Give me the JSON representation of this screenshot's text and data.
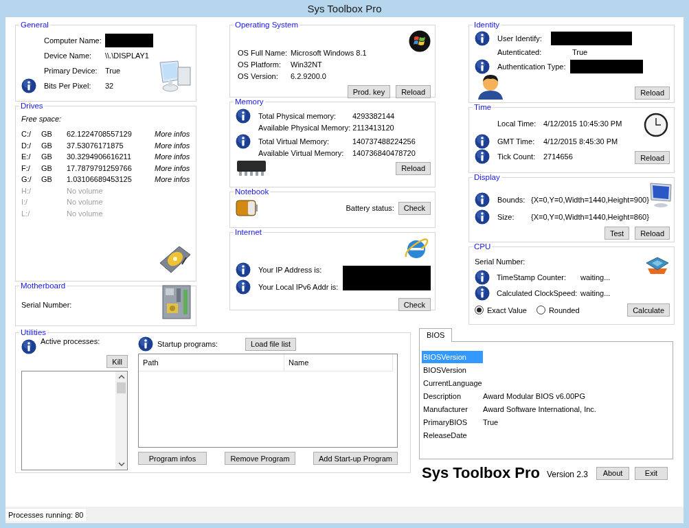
{
  "window": {
    "title": "Sys Toolbox Pro"
  },
  "general": {
    "title": "General",
    "fields": [
      {
        "label": "Computer Name:",
        "redacted": true,
        "info": false
      },
      {
        "label": "Device Name:",
        "value": "\\\\.\\DISPLAY1",
        "info": false
      },
      {
        "label": "Primary Device:",
        "value": "True",
        "info": false
      },
      {
        "label": "Bits Per Pixel:",
        "value": "32",
        "info": true
      }
    ]
  },
  "drives": {
    "title": "Drives",
    "heading": "Free space:",
    "items": [
      {
        "letter": "C:/",
        "unit": "GB",
        "free": "62.1224708557129",
        "link": "More infos",
        "available": true
      },
      {
        "letter": "D:/",
        "unit": "GB",
        "free": "37.53076171875",
        "link": "More infos",
        "available": true
      },
      {
        "letter": "E:/",
        "unit": "GB",
        "free": "30.3294906616211",
        "link": "More infos",
        "available": true
      },
      {
        "letter": "F:/",
        "unit": "GB",
        "free": "17.7879791259766",
        "link": "More infos",
        "available": true
      },
      {
        "letter": "G:/",
        "unit": "GB",
        "free": "1.03106689453125",
        "link": "More infos",
        "available": true
      },
      {
        "letter": "H:/",
        "free": "No volume",
        "available": false
      },
      {
        "letter": "I:/",
        "free": "No volume",
        "available": false
      },
      {
        "letter": "L:/",
        "free": "No volume",
        "available": false
      }
    ]
  },
  "motherboard": {
    "title": "Motherboard",
    "label": "Serial Number:"
  },
  "os": {
    "title": "Operating System",
    "fields": [
      {
        "label": "OS Full Name:",
        "value": "Microsoft Windows 8.1",
        "info": false
      },
      {
        "label": "OS Platform:",
        "value": "Win32NT",
        "info": false
      },
      {
        "label": "OS Version:",
        "value": "6.2.9200.0",
        "info": false
      }
    ],
    "buttons": [
      "Prod. key",
      "Reload"
    ]
  },
  "memory": {
    "title": "Memory",
    "fields": [
      {
        "label": "Total Physical memory:",
        "value": "4293382144",
        "info": true
      },
      {
        "label": "Available Physical Memory:",
        "value": "2113413120",
        "info": false
      },
      {
        "label": "Total Virtual Memory:",
        "value": "140737488224256",
        "info": true
      },
      {
        "label": "Available Virtual Memory:",
        "value": "140736840478720",
        "info": false
      }
    ],
    "buttons": [
      "Reload"
    ]
  },
  "notebook": {
    "title": "Notebook",
    "label": "Battery status:",
    "button": "Check"
  },
  "internet": {
    "title": "Internet",
    "redacted": true,
    "fields": [
      {
        "label": "Your IP Address is:",
        "info": true
      },
      {
        "label": "Your Local IPv6 Addr is:",
        "info": true
      }
    ],
    "button": "Check"
  },
  "identity": {
    "title": "Identity",
    "fields": [
      {
        "label": "User Identify:",
        "redacted": true,
        "info": true
      },
      {
        "label": "Autenticated:",
        "value": "True",
        "info": false
      },
      {
        "label": "Authentication Type:",
        "redacted": true,
        "info": true
      }
    ],
    "button": "Reload"
  },
  "time": {
    "title": "Time",
    "fields": [
      {
        "label": "Local Time:",
        "value": "4/12/2015 10:45:30 PM",
        "info": false
      },
      {
        "label": "GMT Time:",
        "value": "4/12/2015 8:45:30 PM",
        "info": true
      },
      {
        "label": "Tick Count:",
        "value": "2714656",
        "info": true
      }
    ],
    "button": "Reload"
  },
  "display": {
    "title": "Display",
    "fields": [
      {
        "label": "Bounds:",
        "value": "{X=0,Y=0,Width=1440,Height=900}",
        "info": true
      },
      {
        "label": "Size:",
        "value": "{X=0,Y=0,Width=1440,Height=860}",
        "info": true
      }
    ],
    "buttons": [
      "Test",
      "Reload"
    ]
  },
  "cpu": {
    "title": "CPU",
    "serial_label": "Serial Number:",
    "fields": [
      {
        "label": "TimeStamp Counter:",
        "value": "waiting...",
        "info": true
      },
      {
        "label": "Calculated ClockSpeed:",
        "value": "waiting...",
        "info": true
      }
    ],
    "radios": [
      {
        "label": "Exact Value",
        "selected": true
      },
      {
        "label": "Rounded",
        "selected": false
      }
    ],
    "button": "Calculate"
  },
  "utilities": {
    "title": "Utilities",
    "processes_label": "Active processes:",
    "kill_button": "Kill",
    "startup_label": "Startup programs:",
    "load_button": "Load file list",
    "columns": [
      "Path",
      "Name"
    ],
    "buttons": [
      "Program infos",
      "Remove Program",
      "Add Start-up Program"
    ]
  },
  "bios": {
    "tabs": [
      {
        "label": "BIOS",
        "selected": true
      }
    ],
    "rows": [
      {
        "name": "BIOSVersion",
        "selected": true
      },
      {
        "name": "BIOSVersion",
        "selected": false
      },
      {
        "name": "CurrentLanguage",
        "selected": false
      },
      {
        "name": "Description",
        "value": "Award Modular BIOS v6.00PG",
        "selected": false
      },
      {
        "name": "Manufacturer",
        "value": "Award Software International, Inc.",
        "selected": false
      },
      {
        "name": "PrimaryBIOS",
        "value": "True",
        "selected": false
      },
      {
        "name": "ReleaseDate",
        "selected": false
      }
    ]
  },
  "footer": {
    "brand": "Sys Toolbox Pro",
    "version": "Version 2.3",
    "buttons": [
      "About",
      "Exit"
    ]
  },
  "status_bar": {
    "text": "Processes running: 80"
  }
}
